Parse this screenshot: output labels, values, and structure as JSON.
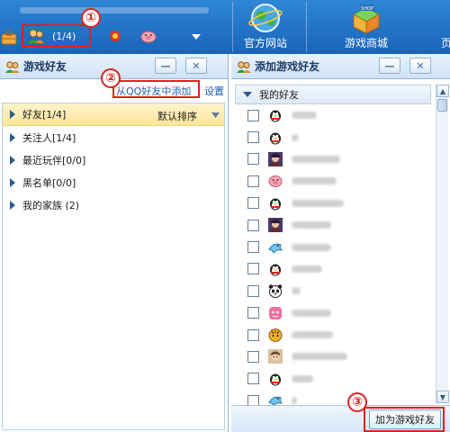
{
  "toolbar": {
    "friend_count": "(1/4)",
    "nav_items": [
      {
        "label": "官方网站",
        "icon": "globe-icon"
      },
      {
        "label": "游戏商城",
        "icon": "shop-icon"
      }
    ],
    "shop_badge": "SHOP",
    "overflow_glyph": "页"
  },
  "annotations": {
    "n1": "①",
    "n2": "②",
    "n3": "③"
  },
  "left_panel": {
    "title": "游戏好友",
    "add_from_qq": "从QQ好友中添加",
    "settings": "设置",
    "sort_label": "默认排序",
    "groups": [
      {
        "label": "好友[1/4]",
        "selected": true
      },
      {
        "label": "关注人[1/4]",
        "selected": false
      },
      {
        "label": "最近玩伴[0/0]",
        "selected": false
      },
      {
        "label": "黑名单[0/0]",
        "selected": false
      },
      {
        "label": "我的家族 (2)",
        "selected": false
      }
    ]
  },
  "right_panel": {
    "title": "添加游戏好友",
    "group_title": "我的好友",
    "add_button": "加为游戏好友",
    "friends": [
      {
        "avatar": "penguin"
      },
      {
        "avatar": "penguin"
      },
      {
        "avatar": "person-dark"
      },
      {
        "avatar": "pig"
      },
      {
        "avatar": "penguin"
      },
      {
        "avatar": "person-dark"
      },
      {
        "avatar": "dolphin"
      },
      {
        "avatar": "penguin"
      },
      {
        "avatar": "panda"
      },
      {
        "avatar": "pink-face"
      },
      {
        "avatar": "tiger"
      },
      {
        "avatar": "person-face"
      },
      {
        "avatar": "penguin"
      },
      {
        "avatar": "dolphin"
      },
      {
        "avatar": "penguin"
      }
    ]
  },
  "colors": {
    "toolbar_blue": "#1a64b8",
    "annotation_red": "#e02020",
    "selected_row": "#ffe59a",
    "link_blue": "#1f5fb0"
  }
}
